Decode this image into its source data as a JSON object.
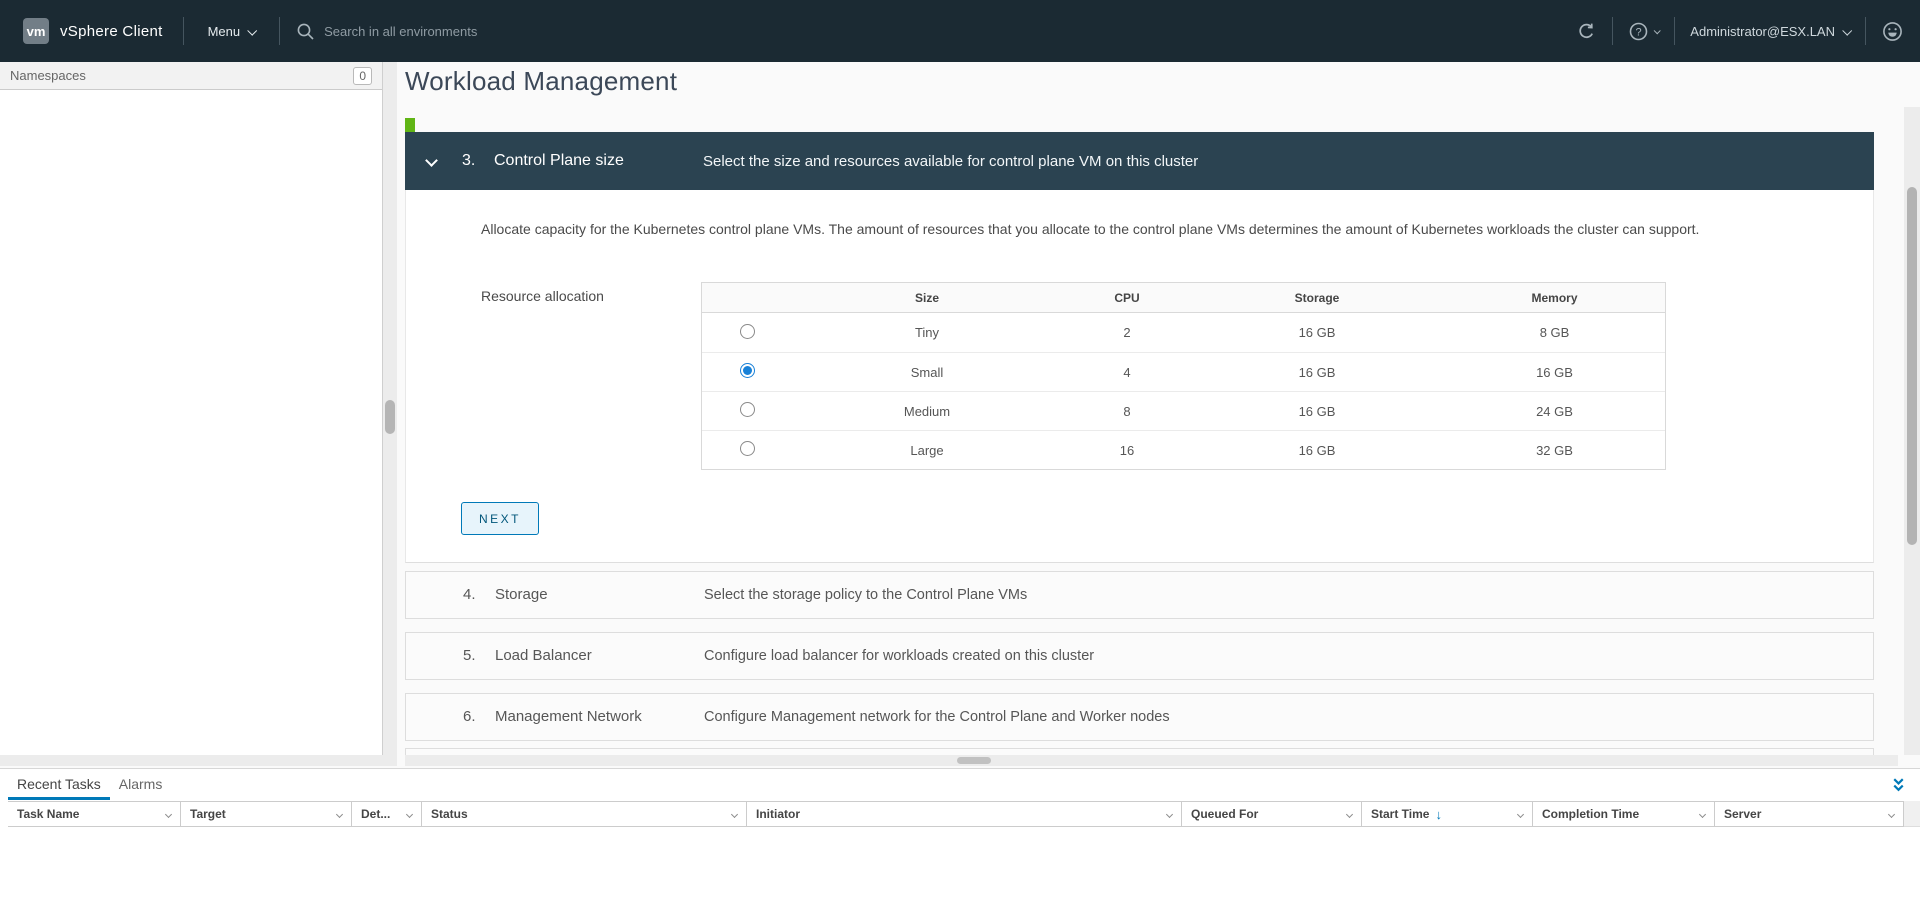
{
  "topnav": {
    "logo": "vm",
    "product_name": "vSphere Client",
    "menu_label": "Menu",
    "search_placeholder": "Search in all environments",
    "account_name": "Administrator@ESX.LAN"
  },
  "sidebar": {
    "header": "Namespaces",
    "count_badge": "0"
  },
  "page": {
    "title": "Workload Management"
  },
  "wizard": {
    "active_step": {
      "number": "3.",
      "title": "Control Plane size",
      "summary": "Select the size and resources available for control plane VM on this cluster",
      "description": "Allocate capacity for the Kubernetes control plane VMs. The amount of resources that you allocate to the control plane VMs determines the amount of Kubernetes workloads the cluster can support.",
      "field_label": "Resource allocation",
      "next_button": "NEXT",
      "size_table": {
        "columns": [
          "Size",
          "CPU",
          "Storage",
          "Memory"
        ],
        "rows": [
          {
            "selected": false,
            "size": "Tiny",
            "cpu": "2",
            "storage": "16 GB",
            "memory": "8 GB"
          },
          {
            "selected": true,
            "size": "Small",
            "cpu": "4",
            "storage": "16 GB",
            "memory": "16 GB"
          },
          {
            "selected": false,
            "size": "Medium",
            "cpu": "8",
            "storage": "16 GB",
            "memory": "24 GB"
          },
          {
            "selected": false,
            "size": "Large",
            "cpu": "16",
            "storage": "16 GB",
            "memory": "32 GB"
          }
        ]
      }
    },
    "collapsed_steps": [
      {
        "number": "4.",
        "title": "Storage",
        "summary": "Select the storage policy to the Control Plane VMs"
      },
      {
        "number": "5.",
        "title": "Load Balancer",
        "summary": "Configure load balancer for workloads created on this cluster"
      },
      {
        "number": "6.",
        "title": "Management Network",
        "summary": "Configure Management network for the Control Plane and Worker nodes"
      }
    ]
  },
  "tasks_panel": {
    "tabs": [
      {
        "label": "Recent Tasks",
        "active": true
      },
      {
        "label": "Alarms",
        "active": false
      }
    ],
    "columns": [
      {
        "label": "Task Name"
      },
      {
        "label": "Target"
      },
      {
        "label": "Det..."
      },
      {
        "label": "Status"
      },
      {
        "label": "Initiator"
      },
      {
        "label": "Queued For"
      },
      {
        "label": "Start Time",
        "sorted": "desc"
      },
      {
        "label": "Completion Time"
      },
      {
        "label": "Server"
      }
    ]
  },
  "colors": {
    "topnav_bg": "#1b2a33",
    "step_header_bg": "#2b4351",
    "accent_blue": "#0079b8",
    "green_marker": "#60b515",
    "selected_radio": "#1881d8"
  }
}
